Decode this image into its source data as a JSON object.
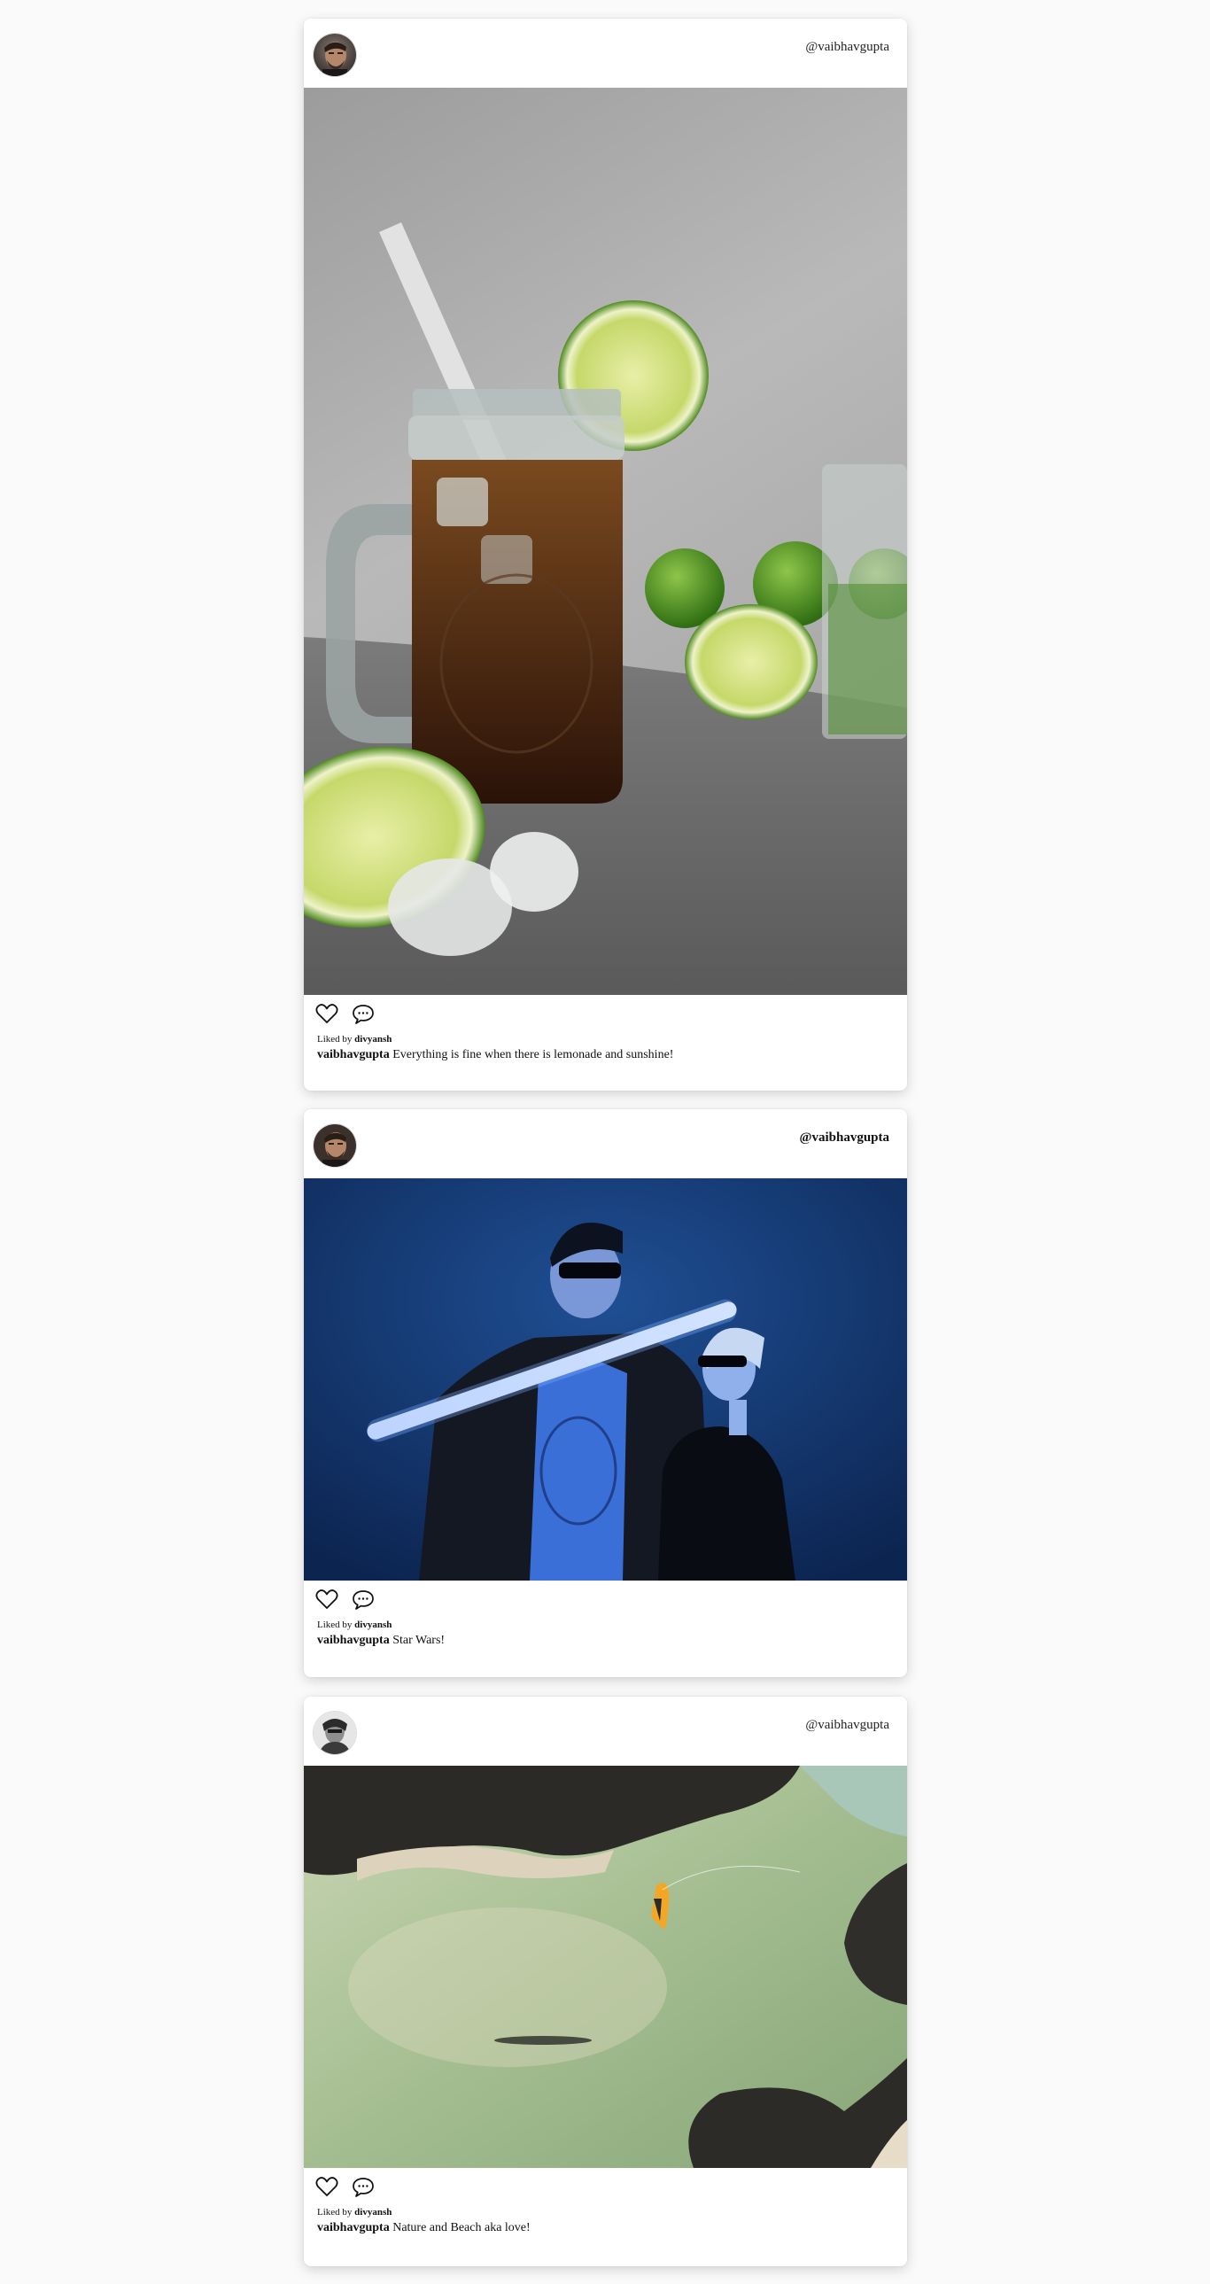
{
  "posts": [
    {
      "handle": "@vaibhavgupta",
      "avatar": "man-face-avatar",
      "image": "iced-cola-with-limes-photo",
      "liked_prefix": "Liked by",
      "liked_user": "divyansh",
      "caption_user": "vaibhavgupta",
      "caption_text": "Everything is fine when there is lemonade and sunshine!",
      "icons": [
        "heart-icon",
        "comment-icon"
      ]
    },
    {
      "handle": "@vaibhavgupta",
      "avatar": "man-face-avatar",
      "image": "couple-with-neon-light-saber-photo",
      "liked_prefix": "Liked by",
      "liked_user": "divyansh",
      "caption_user": "vaibhavgupta",
      "caption_text": "Star Wars!",
      "icons": [
        "heart-icon",
        "comment-icon"
      ]
    },
    {
      "handle": "@vaibhavgupta",
      "avatar": "grayscale-face-avatar",
      "image": "aerial-beach-kitesurfer-photo",
      "liked_prefix": "Liked by",
      "liked_user": "divyansh",
      "caption_user": "vaibhavgupta",
      "caption_text": "Nature and Beach aka love!",
      "icons": [
        "heart-icon",
        "comment-icon"
      ]
    }
  ]
}
